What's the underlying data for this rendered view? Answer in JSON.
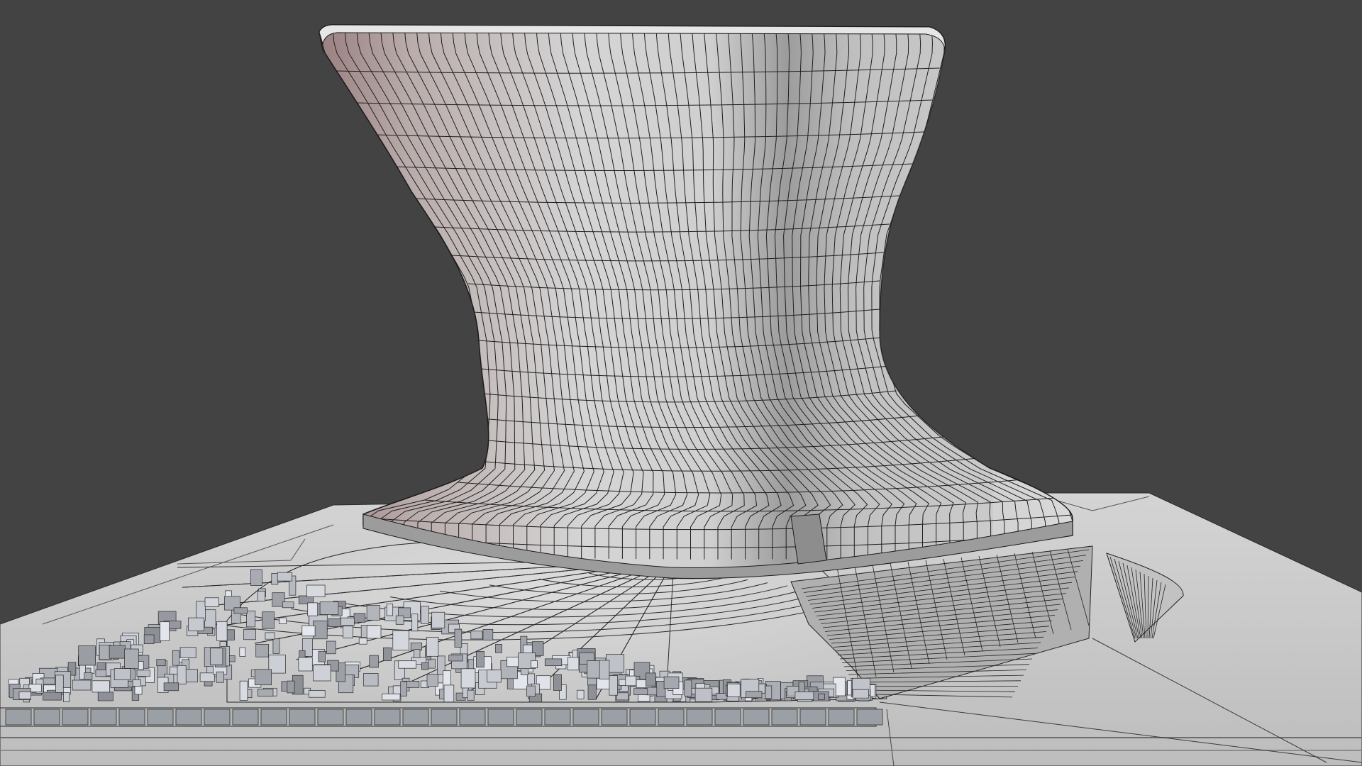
{
  "viewport": {
    "background": "#434343",
    "model": "curved-tower-wireframe",
    "shading": "solid-with-wireframe-overlay",
    "colors": {
      "surface_light": "#d9d9d9",
      "surface_mid": "#b8b8b8",
      "surface_shadow": "#8a8a8a",
      "warm_edge": "#a08080",
      "wire": "#1c1c1c",
      "ground": "#c9c9c9",
      "debris": "#9aa3ad"
    }
  }
}
